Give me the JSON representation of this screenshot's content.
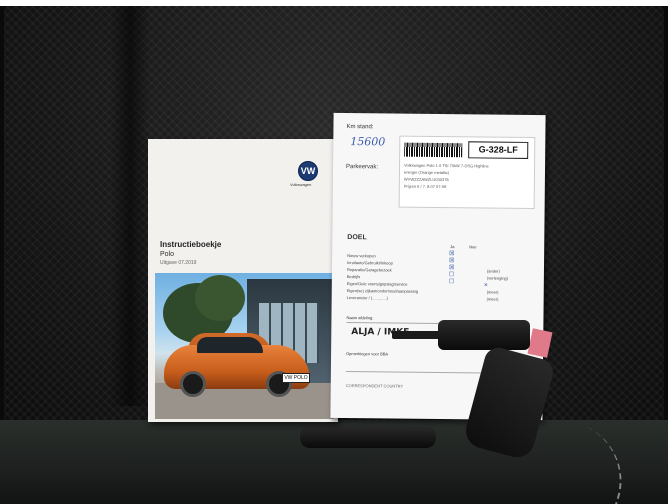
{
  "manual": {
    "brand": "Volkswagen",
    "logo": "VW",
    "title": "Instructieboekje",
    "model": "Polo",
    "edition": "Uitgave 07.2019",
    "plate": "VW POLO"
  },
  "service_form": {
    "km_label": "Km stand:",
    "km_value": "15600",
    "parking_label": "Parkeervak:",
    "registration": "G-328-LF",
    "sticker_lines": [
      "Volkswagen Polo 1.0 TSI 70kW 7-DSG Highline",
      "energie (Orange metallic)",
      "WVWZZZAWZLU030378",
      "Prijzen  6 / 7, 8.07  07-09"
    ],
    "doel": "DOEL",
    "col_yes": "Ja",
    "col_no": "Nee",
    "rows": [
      "Nieuw verkopen",
      "Inruilauto/Gebruikt/Inkoop",
      "Reparatie/Garagebezoek",
      "Bedrijfs",
      "Eigen/Gele voertuigopslag/service",
      "Eigen(se) zijkant/onderhoud/aanpassing",
      "Leverancier / (.............)"
    ],
    "extra_options": [
      "(ander)",
      "(verlenging)",
      "(meer)",
      "(meer)"
    ],
    "name_label": "Naam afdeling:",
    "signature": "ALJA / IMKE",
    "remarks_label": "Opmerkingen voor BBA",
    "footer_label": "CORRESPONDENT COUNTRY"
  },
  "colors": {
    "seat": "#1a1a1a",
    "car": "#d96a28",
    "vw_blue": "#1c3b72"
  }
}
